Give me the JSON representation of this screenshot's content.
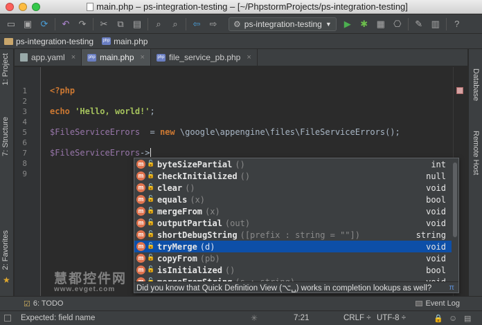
{
  "window": {
    "title": "main.php – ps-integration-testing – [~/PhpstormProjects/ps-integration-testing]"
  },
  "toolbar": {
    "run_config": "ps-integration-testing"
  },
  "breadcrumbs": [
    "ps-integration-testing",
    "main.php"
  ],
  "left_tabs": {
    "project": "1: Project",
    "structure": "7: Structure",
    "favorites": "2: Favorites"
  },
  "right_tabs": {
    "database": "Database",
    "remote_host": "Remote Host"
  },
  "editor_tabs": [
    {
      "label": "app.yaml"
    },
    {
      "label": "main.php",
      "active": true
    },
    {
      "label": "file_service_pb.php"
    }
  ],
  "line_numbers": [
    "1",
    "2",
    "3",
    "4",
    "5",
    "6",
    "7",
    "8",
    "9"
  ],
  "code": {
    "line1": "<?php",
    "line3_kw": "echo",
    "line3_str": "'Hello, world!'",
    "line3_end": ";",
    "line5_var": "$FileServiceErrors",
    "line5_eq": "  = ",
    "line5_new": "new",
    "line5_rest": " \\google\\appengine\\files\\FileServiceErrors();",
    "line7_var": "$FileServiceErrors",
    "line7_arrow": "->"
  },
  "completion": {
    "items": [
      {
        "name": "byteSizePartial",
        "args": "()",
        "type": "int"
      },
      {
        "name": "checkInitialized",
        "args": "()",
        "type": "null"
      },
      {
        "name": "clear",
        "args": "()",
        "type": "void"
      },
      {
        "name": "equals",
        "args": "(x)",
        "type": "bool"
      },
      {
        "name": "mergeFrom",
        "args": "(x)",
        "type": "void"
      },
      {
        "name": "outputPartial",
        "args": "(out)",
        "type": "void"
      },
      {
        "name": "shortDebugString",
        "args": "([prefix : string = \"\"])",
        "type": "string"
      },
      {
        "name": "tryMerge",
        "args": "(d)",
        "type": "void",
        "selected": true
      },
      {
        "name": "copyFrom",
        "args": "(pb)",
        "type": "void"
      },
      {
        "name": "isInitialized",
        "args": "()",
        "type": "bool"
      },
      {
        "name": "mergeFromString",
        "args": "(s : string)",
        "type": "void"
      }
    ],
    "hint": "Did you know that Quick Definition View (⌥␣) works in completion lookups as well?",
    "hint_icon": "π"
  },
  "watermark": {
    "line1": "慧都控件网",
    "line2": "www.evget.com"
  },
  "bottom_bar": {
    "todo": "6: TODO",
    "event_log": "Event Log"
  },
  "status": {
    "message": "Expected: field name",
    "position": "7:21",
    "line_sep": "CRLF ÷",
    "encoding": "UTF-8 ÷"
  },
  "colors": {
    "selection": "#0d4fa8",
    "method_icon": "#e0734e",
    "keyword": "#cc7832",
    "string": "#a5c25c",
    "variable": "#9876aa"
  }
}
